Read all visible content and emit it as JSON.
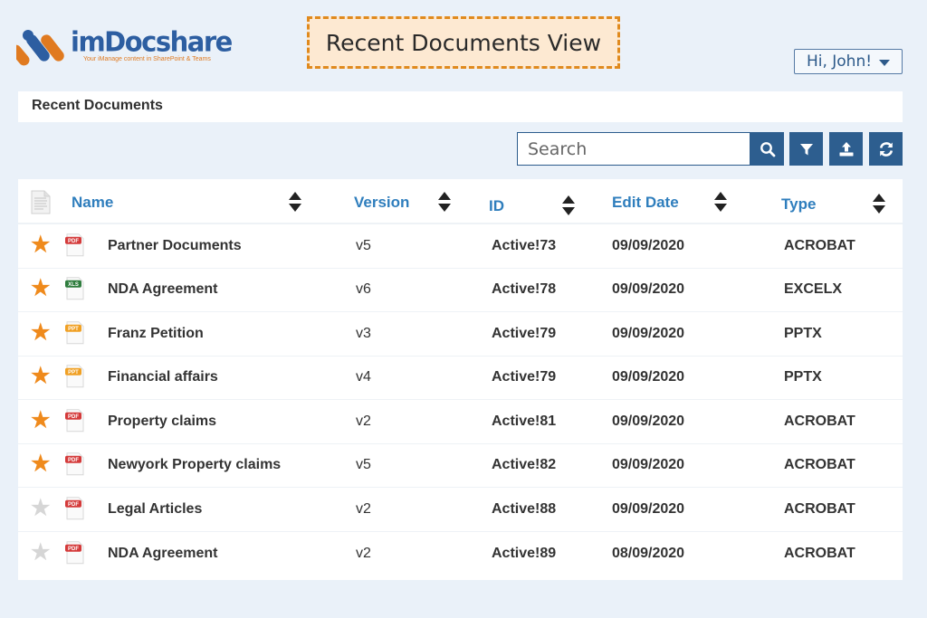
{
  "brand": {
    "name": "imDocshare",
    "tagline": "Your iManage content in SharePoint & Teams",
    "colors": {
      "blue": "#2d5ea1",
      "orange": "#e07a20"
    }
  },
  "banner": {
    "title": "Recent Documents View"
  },
  "user_menu": {
    "label": "Hi, John!",
    "icon": "caret-down-icon"
  },
  "section": {
    "title": "Recent Documents"
  },
  "toolbar": {
    "search_placeholder": "Search",
    "search_value": "",
    "buttons": [
      {
        "name": "search-button",
        "icon": "search-icon"
      },
      {
        "name": "filter-button",
        "icon": "filter-icon"
      },
      {
        "name": "upload-button",
        "icon": "upload-icon"
      },
      {
        "name": "refresh-button",
        "icon": "refresh-icon"
      }
    ],
    "accent": "#2d5e8f"
  },
  "table": {
    "columns": {
      "file_icon": "document-icon",
      "name": "Name",
      "version": "Version",
      "id": "ID",
      "edit_date": "Edit Date",
      "type": "Type"
    },
    "header_color": "#2f7ebd",
    "rows": [
      {
        "favorite": true,
        "filetype": "PDF",
        "name": "Partner Documents",
        "version": "v5",
        "id": "Active!73",
        "edit_date": "09/09/2020",
        "type": "ACROBAT"
      },
      {
        "favorite": true,
        "filetype": "XLS",
        "name": "NDA Agreement",
        "version": "v6",
        "id": "Active!78",
        "edit_date": "09/09/2020",
        "type": "EXCELX"
      },
      {
        "favorite": true,
        "filetype": "PPT",
        "name": "Franz Petition",
        "version": "v3",
        "id": "Active!79",
        "edit_date": "09/09/2020",
        "type": "PPTX"
      },
      {
        "favorite": true,
        "filetype": "PPT",
        "name": "Financial affairs",
        "version": "v4",
        "id": "Active!79",
        "edit_date": "09/09/2020",
        "type": "PPTX"
      },
      {
        "favorite": true,
        "filetype": "PDF",
        "name": "Property claims",
        "version": "v2",
        "id": "Active!81",
        "edit_date": "09/09/2020",
        "type": "ACROBAT"
      },
      {
        "favorite": true,
        "filetype": "PDF",
        "name": "Newyork Property claims",
        "version": "v5",
        "id": "Active!82",
        "edit_date": "09/09/2020",
        "type": "ACROBAT"
      },
      {
        "favorite": false,
        "filetype": "PDF",
        "name": "Legal Articles",
        "version": "v2",
        "id": "Active!88",
        "edit_date": "09/09/2020",
        "type": "ACROBAT"
      },
      {
        "favorite": false,
        "filetype": "PDF",
        "name": "NDA Agreement",
        "version": "v2",
        "id": "Active!89",
        "edit_date": "08/09/2020",
        "type": "ACROBAT"
      }
    ],
    "colors": {
      "star_on": "#ef8a1c",
      "star_off": "#d6d6d6",
      "pdf": "#d43a3a",
      "xls": "#2f7d3e",
      "ppt": "#f0a024"
    }
  }
}
